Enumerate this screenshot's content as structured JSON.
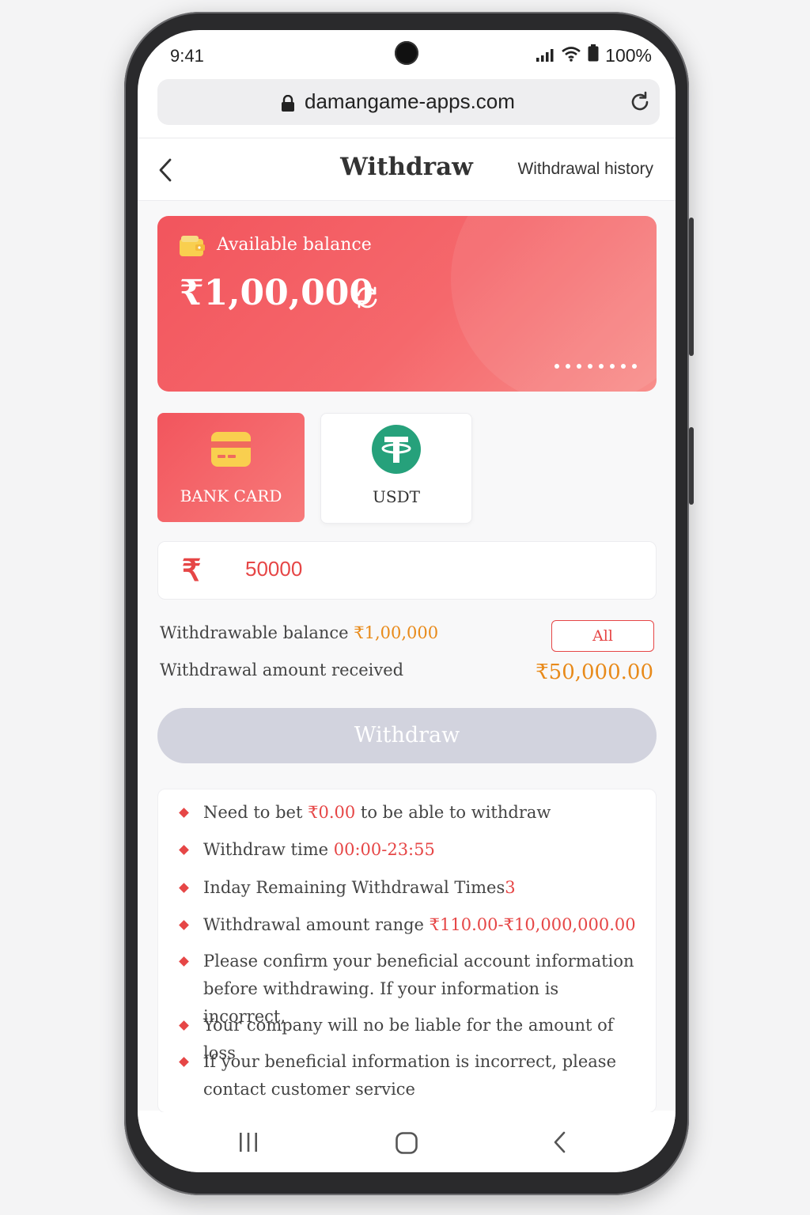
{
  "status_bar": {
    "time": "9:41",
    "battery": "100%",
    "icons": [
      "signal-icon",
      "wifi-icon",
      "battery-icon"
    ]
  },
  "browser": {
    "url": "damangame-apps.com",
    "icons": [
      "lock-icon",
      "reload-icon"
    ]
  },
  "header": {
    "title": "Withdraw",
    "history_label": "Withdrawal history",
    "back_icon": "chevron-left-icon"
  },
  "balance_card": {
    "label": "Available balance",
    "amount": "₹1,00,000",
    "icons": [
      "wallet-icon",
      "refresh-icon"
    ]
  },
  "methods": [
    {
      "label": "BANK CARD",
      "icon": "bank-card-icon",
      "selected": true
    },
    {
      "label": "USDT",
      "icon": "tether-icon",
      "selected": false
    }
  ],
  "amount_input": {
    "currency_symbol": "₹",
    "value": "50000"
  },
  "summary": {
    "withdrawable_label": "Withdrawable balance",
    "withdrawable_value": "₹1,00,000",
    "all_button": "All",
    "received_label": "Withdrawal amount received",
    "received_value": "₹50,000.00"
  },
  "withdraw_button": "Withdraw",
  "rules": [
    {
      "text_before": "Need to bet ",
      "highlight": "₹0.00",
      "text_after": " to be able to withdraw"
    },
    {
      "text_before": "Withdraw time ",
      "highlight": "00:00-23:55",
      "text_after": ""
    },
    {
      "text_before": "Inday Remaining Withdrawal Times",
      "highlight": "3",
      "text_after": ""
    },
    {
      "text_before": "Withdrawal amount range ",
      "highlight": "₹110.00-₹10,000,000.00",
      "text_after": ""
    },
    {
      "text_before": "Please confirm your beneficial account information before withdrawing. If your information is incorrect,",
      "highlight": "",
      "text_after": ""
    },
    {
      "text_before": "Your company will no be liable for the amount of loss",
      "highlight": "",
      "text_after": ""
    },
    {
      "text_before": "If your beneficial information is incorrect, please contact customer service",
      "highlight": "",
      "text_after": ""
    }
  ],
  "system_nav": {
    "icons": [
      "recent-apps-icon",
      "home-icon",
      "back-icon"
    ]
  },
  "colors": {
    "accent": "#e64646",
    "orange": "#e88a1a",
    "usdt_green": "#26a17b",
    "disabled_button": "#d2d3de"
  }
}
